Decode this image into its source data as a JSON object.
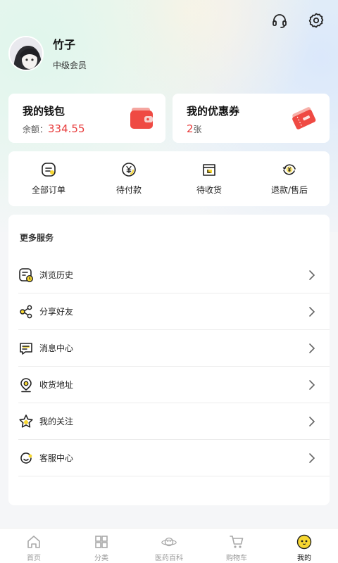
{
  "header": {
    "headset_icon": "headset-icon",
    "settings_icon": "gear-icon"
  },
  "profile": {
    "name": "竹子",
    "level": "中级会员"
  },
  "wallet": {
    "title": "我的钱包",
    "balance_label": "余额：",
    "balance_value": "334.55"
  },
  "coupon": {
    "title": "我的优惠券",
    "count": "2",
    "unit": "张"
  },
  "orders": {
    "items": [
      {
        "label": "全部订单",
        "icon": "list-icon"
      },
      {
        "label": "待付款",
        "icon": "yen-coin-icon"
      },
      {
        "label": "待收货",
        "icon": "package-icon"
      },
      {
        "label": "退款/售后",
        "icon": "refund-icon"
      }
    ]
  },
  "services": {
    "title": "更多服务",
    "items": [
      {
        "label": "浏览历史",
        "icon": "history-icon"
      },
      {
        "label": "分享好友",
        "icon": "share-icon"
      },
      {
        "label": "消息中心",
        "icon": "message-icon"
      },
      {
        "label": "收货地址",
        "icon": "location-icon"
      },
      {
        "label": "我的关注",
        "icon": "star-icon"
      },
      {
        "label": "客服中心",
        "icon": "customer-service-icon"
      }
    ]
  },
  "tabbar": {
    "items": [
      {
        "label": "首页",
        "icon": "home-icon"
      },
      {
        "label": "分类",
        "icon": "grid-icon"
      },
      {
        "label": "医药百科",
        "icon": "planet-icon"
      },
      {
        "label": "购物车",
        "icon": "cart-icon"
      },
      {
        "label": "我的",
        "icon": "smiley-icon",
        "active": true
      }
    ]
  },
  "colors": {
    "accent_red": "#e83c3c",
    "accent_yellow": "#f7d731",
    "card_bg": "#ffffff"
  }
}
